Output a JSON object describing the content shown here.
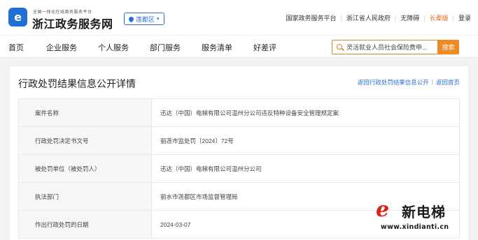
{
  "header": {
    "logo_glyph": "e",
    "logo_subtitle": "全国一体化在线政务服务平台",
    "site_name": "浙江政务服务网",
    "region_label": "莲都区",
    "top_links": [
      "国家政务服务平台",
      "浙江省人民政府",
      "无障碍",
      "长辈版",
      "登录"
    ],
    "accent_color": "#e06a1b",
    "brand_color": "#1f6fd6"
  },
  "nav": {
    "items": [
      "首页",
      "企业服务",
      "个人服务",
      "部门服务",
      "服务清单",
      "好差评"
    ],
    "search_value": "灵活就业人员社会保险费申...",
    "search_button": "搜索"
  },
  "card": {
    "title": "行政处罚结果信息公开详情",
    "links": [
      "返回行政处罚结果信息公开",
      "返回首页"
    ],
    "rows": [
      {
        "label": "案件名称",
        "value": "迅达（中国）电梯有限公司温州分公司违反特种设备安全管理规定案"
      },
      {
        "label": "行政处罚决定书文号",
        "value": "丽莲市监处罚〔2024〕72号"
      },
      {
        "label": "被处罚单位（被处罚人）",
        "value": "迅达（中国）电梯有限公司温州分公司"
      },
      {
        "label": "执法部门",
        "value": "丽水市莲都区市场监督管理局"
      },
      {
        "label": "作出行政处罚的日期",
        "value": "2024-03-07"
      }
    ]
  },
  "watermark": {
    "brand": "新电梯",
    "url": "www.xindianti.cn",
    "color": "#d9231d"
  }
}
